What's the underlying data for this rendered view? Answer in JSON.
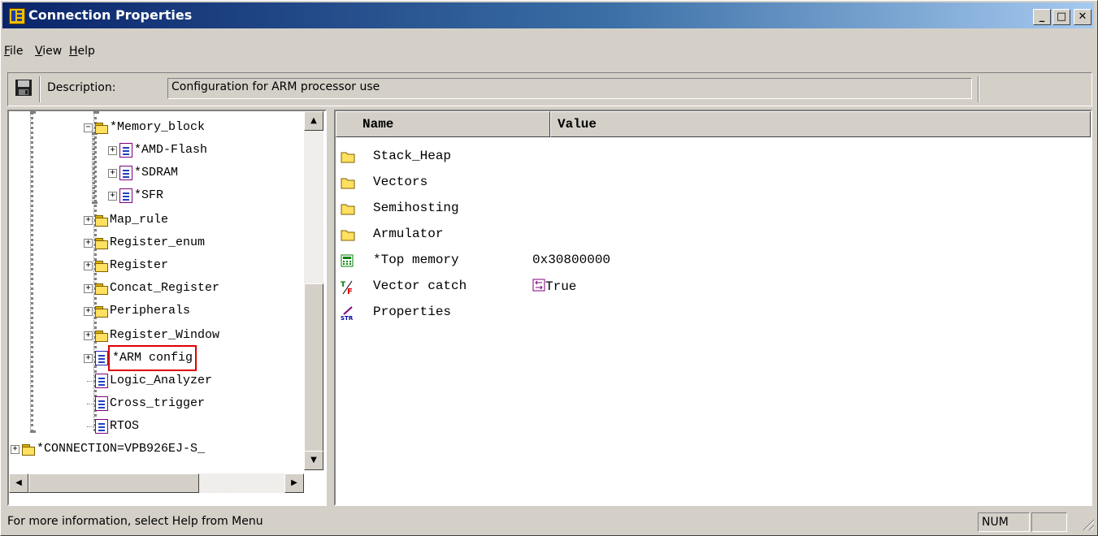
{
  "window": {
    "title": "Connection Properties",
    "controls": {
      "minimize": "_",
      "maximize": "□",
      "close": "✕"
    }
  },
  "menu": {
    "file_mnemonic": "F",
    "file_rest": "ile",
    "view_mnemonic": "V",
    "view_rest": "iew",
    "help_mnemonic": "H",
    "help_rest": "elp"
  },
  "toolbar": {
    "save_icon": "floppy-disk-icon",
    "description_label": "Description:",
    "description_value": "Configuration for ARM processor use"
  },
  "tree": {
    "nodes": [
      {
        "label": "*Memory_block",
        "icon": "folder",
        "expander": "−"
      },
      {
        "label": "*AMD-Flash",
        "icon": "doc",
        "expander": "+"
      },
      {
        "label": "*SDRAM",
        "icon": "doc",
        "expander": "+"
      },
      {
        "label": "*SFR",
        "icon": "doc",
        "expander": "+"
      },
      {
        "label": "Map_rule",
        "icon": "folder",
        "expander": "+"
      },
      {
        "label": "Register_enum",
        "icon": "folder",
        "expander": "+"
      },
      {
        "label": "Register",
        "icon": "folder",
        "expander": "+"
      },
      {
        "label": "Concat_Register",
        "icon": "folder",
        "expander": "+"
      },
      {
        "label": "Peripherals",
        "icon": "folder",
        "expander": "+"
      },
      {
        "label": "Register_Window",
        "icon": "folder",
        "expander": "+"
      },
      {
        "label": "*ARM config",
        "icon": "doc-edit",
        "expander": "+",
        "selected": true
      },
      {
        "label": "Logic_Analyzer",
        "icon": "doc",
        "expander": ""
      },
      {
        "label": "Cross_trigger",
        "icon": "doc",
        "expander": ""
      },
      {
        "label": "RTOS",
        "icon": "doc",
        "expander": ""
      },
      {
        "label": "*CONNECTION=VPB926EJ-S_",
        "icon": "folder",
        "expander": "+"
      }
    ]
  },
  "list": {
    "columns": {
      "name": "Name",
      "value": "Value"
    },
    "rows": [
      {
        "name": "Stack_Heap",
        "value": "",
        "icon": "folder"
      },
      {
        "name": "Vectors",
        "value": "",
        "icon": "folder"
      },
      {
        "name": "Semihosting",
        "value": "",
        "icon": "folder"
      },
      {
        "name": "Armulator",
        "value": "",
        "icon": "folder"
      },
      {
        "name": "*Top memory",
        "value": "0x30800000",
        "icon": "numeric-icon"
      },
      {
        "name": "Vector catch",
        "value": "True",
        "icon": "boolean-tf-icon"
      },
      {
        "name": "Properties",
        "value": "",
        "icon": "string-icon"
      }
    ]
  },
  "status": {
    "text": "For more information, select Help from Menu",
    "num": "NUM"
  }
}
